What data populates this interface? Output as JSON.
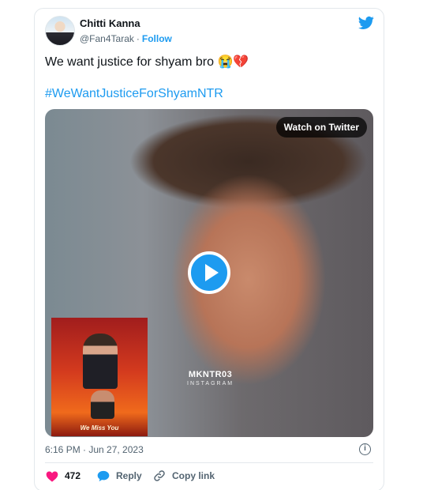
{
  "author": {
    "name": "Chitti Kanna",
    "handle": "@Fan4Tarak",
    "separator": "·",
    "follow_label": "Follow"
  },
  "tweet": {
    "text": "We want justice for shyam bro 😭💔",
    "hashtag": "#WeWantJusticeForShyamNTR"
  },
  "media": {
    "watch_label": "Watch on Twitter",
    "watermark_main": "MKNTR03",
    "watermark_sub": "INSTAGRAM",
    "inset_caption": "We Miss You"
  },
  "meta": {
    "timestamp": "6:16 PM · Jun 27, 2023"
  },
  "actions": {
    "like_count": "472",
    "reply_label": "Reply",
    "copy_label": "Copy link"
  },
  "colors": {
    "accent": "#1d9bf0",
    "like": "#f91880",
    "text": "#0f1419",
    "muted": "#536471",
    "border": "#e3e8ec"
  }
}
